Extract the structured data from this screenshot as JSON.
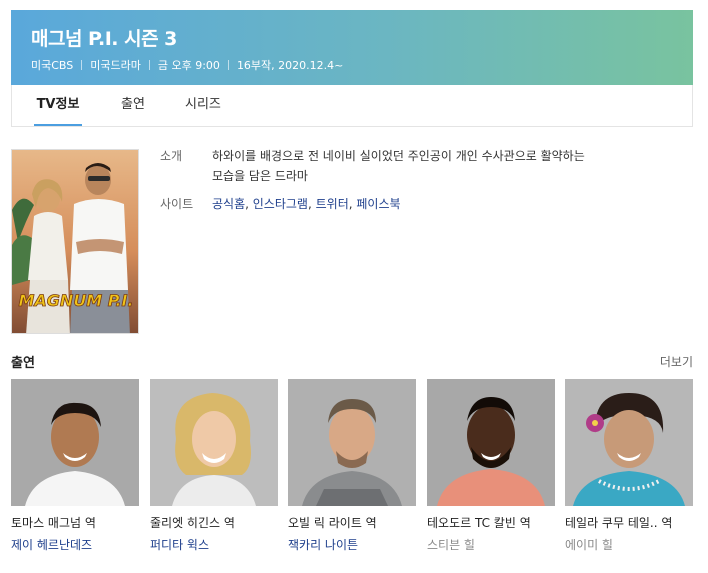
{
  "show": {
    "title": "매그넘 P.I. 시즌 3",
    "meta": [
      "미국CBS",
      "미국드라마",
      "금 오후 9:00",
      "16부작, 2020.12.4~"
    ]
  },
  "tabs": [
    "TV정보",
    "출연",
    "시리즈"
  ],
  "info": {
    "synopsis_label": "소개",
    "synopsis_line1": "하와이를 배경으로 전 네이비 실이었던 주인공이 개인 수사관으로 활약하는",
    "synopsis_line2": "모습을 담은 드라마",
    "site_label": "사이트",
    "sites": [
      "공식홈",
      "인스타그램",
      "트위터",
      "페이스북"
    ]
  },
  "poster": {
    "logo_text": "MAGNUM P.I."
  },
  "cast_section": {
    "title": "출연",
    "more": "더보기"
  },
  "cast": [
    {
      "role": "토마스 매그넘 역",
      "actor": "제이 헤르난데즈"
    },
    {
      "role": "줄리엣 히긴스 역",
      "actor": "퍼디타 윅스"
    },
    {
      "role": "오빌 릭 라이트 역",
      "actor": "잭카리 나이튼"
    },
    {
      "role": "테오도르 TC 칼빈 역",
      "actor": "스티븐 힐"
    },
    {
      "role": "테일라 쿠무 테일.. 역",
      "actor": "에이미 힐"
    }
  ]
}
